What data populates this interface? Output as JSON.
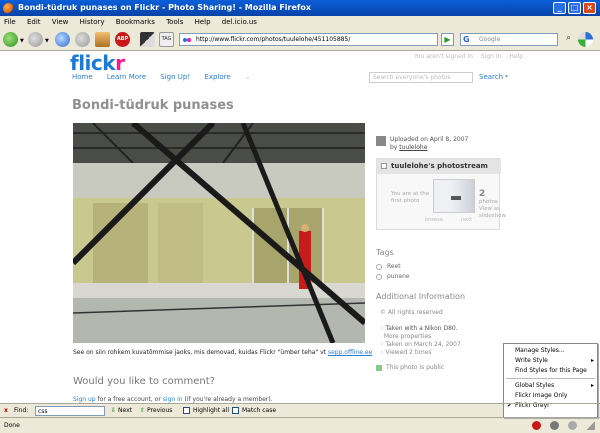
{
  "window": {
    "title": "Bondi-tüdruk punases on Flickr - Photo Sharing! - Mozilla Firefox",
    "min": "_",
    "max": "□",
    "close": "×"
  },
  "menu": [
    "File",
    "Edit",
    "View",
    "History",
    "Bookmarks",
    "Tools",
    "Help",
    "del.icio.us"
  ],
  "toolbar": {
    "url": "http://www.flickr.com/photos/tuulelohe/451105885/",
    "go": "▶",
    "search_engine": "G",
    "search_placeholder": "Google",
    "tag": "TAG",
    "abp": "ABP"
  },
  "flickr": {
    "logo_a": "flick",
    "logo_b": "r",
    "signin": [
      "You aren't signed in",
      "Sign In",
      "Help"
    ],
    "nav": [
      "Home",
      "Learn More",
      "Sign Up!",
      "Explore"
    ],
    "search_placeholder": "Search everyone's photos",
    "search_button": "Search",
    "title": "Bondi-tüdruk punases",
    "caption_text": "See on siin rohkem kuvatõmmise jaoks, mis demovad, kuidas Flickr \"ümber teha\" vt",
    "caption_link": "sepp.offline.ee",
    "comment_heading": "Would you like to comment?",
    "signup_link": "Sign up",
    "signup_text": "for a free account, or",
    "signin_link": "sign in",
    "signup_tail": "(if you're already a member).",
    "uploaded": "Uploaded on April 8, 2007",
    "uploaded_by": "by",
    "uploader": "tuulelohe",
    "stream_title": "tuulelohe's photostream",
    "stream_first": "You are at the first photo",
    "stream_count": "2",
    "stream_photos": "photos",
    "stream_view": "View as slideshow",
    "stream_prev": "browse",
    "stream_next": "next",
    "tags_heading": "Tags",
    "tags": [
      "Reet",
      "punane"
    ],
    "info_heading": "Additional Information",
    "rights": "All rights reserved",
    "camera": "Taken with a Nikon D80.",
    "more_props": "More properties",
    "taken": "Taken on March 24, 2007",
    "views": "Viewed 2 times",
    "public_text": "This photo is public"
  },
  "context_menu": {
    "items": [
      "Manage Styles...",
      "Write Style",
      "Find Styles for this Page",
      "Global Styles",
      "Flickr Image Only",
      "Flickr Greyr"
    ],
    "checked": "Flickr Greyr"
  },
  "findbar": {
    "close": "x",
    "label": "Find:",
    "value": "css",
    "next": "Next",
    "previous": "Previous",
    "highlight": "Highlight all",
    "matchcase": "Match case"
  },
  "status": {
    "text": "Done"
  }
}
